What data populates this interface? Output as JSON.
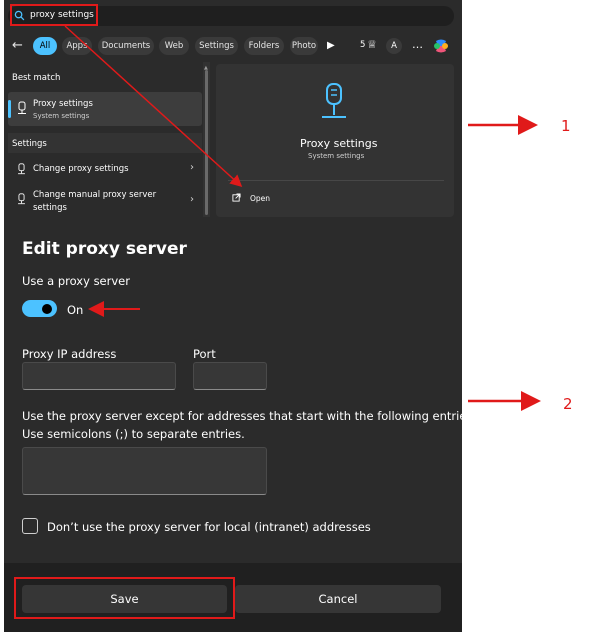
{
  "search": {
    "query": "proxy settings",
    "filters": [
      "All",
      "Apps",
      "Documents",
      "Web",
      "Settings",
      "Folders",
      "Photo"
    ],
    "points": "5",
    "avatar_letter": "A",
    "more": "…"
  },
  "results": {
    "best_match_heading": "Best match",
    "best": {
      "title": "Proxy settings",
      "subtitle": "System settings"
    },
    "settings_heading": "Settings",
    "items": [
      {
        "label": "Change proxy settings"
      },
      {
        "label_line1": "Change manual proxy server",
        "label_line2": "settings"
      }
    ]
  },
  "preview": {
    "title": "Proxy settings",
    "subtitle": "System settings",
    "open_label": "Open"
  },
  "dialog": {
    "title": "Edit proxy server",
    "use_proxy_label": "Use a proxy server",
    "toggle_state": "On",
    "ip_label": "Proxy IP address",
    "ip_value": "",
    "port_label": "Port",
    "port_value": "",
    "exceptions_line1": "Use the proxy server except for addresses that start with the following entries.",
    "exceptions_line2": "Use semicolons (;) to separate entries.",
    "exceptions_value": "",
    "local_checkbox_label": "Don’t use the proxy server for local (intranet) addresses",
    "local_checked": false,
    "save_label": "Save",
    "cancel_label": "Cancel"
  },
  "annotations": {
    "step1": "1",
    "step2": "2",
    "color": "#e01a1a"
  },
  "colors": {
    "accent": "#4cc2ff",
    "panel_bg": "#2b2b2b",
    "annotation_red": "#e01a1a"
  }
}
